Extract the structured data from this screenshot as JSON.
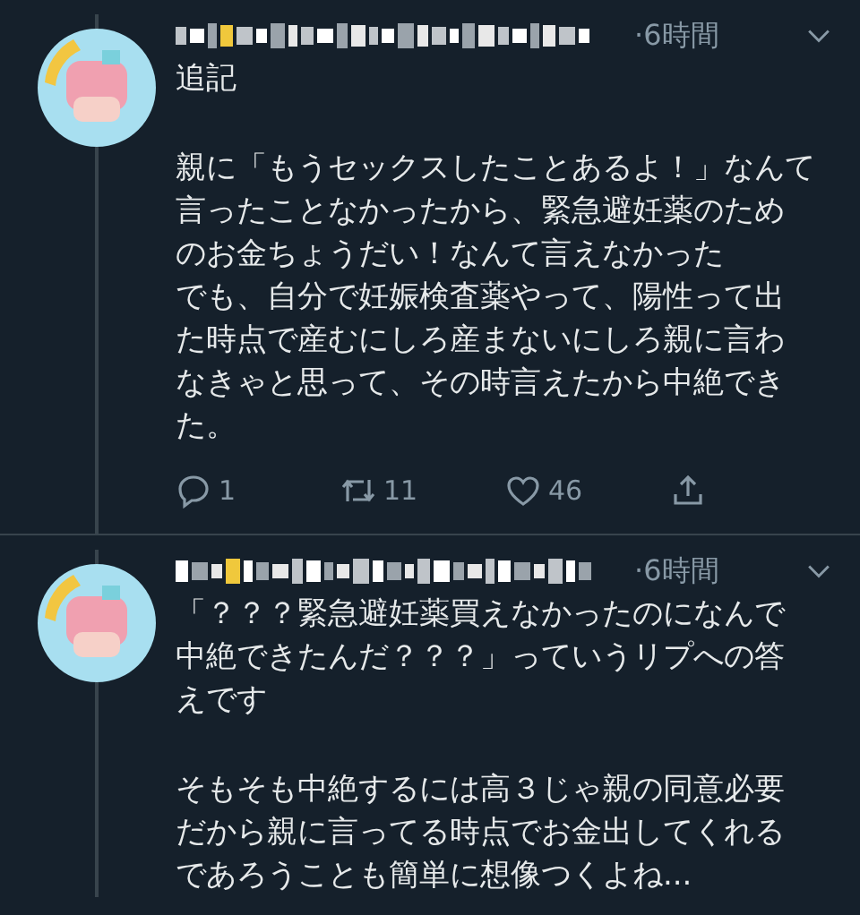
{
  "tweets": [
    {
      "time": "·6時間",
      "paragraphs": [
        [
          "追記"
        ],
        [
          "親に「もうセックスしたことあるよ！」なんて",
          "言ったことなかったから、緊急避妊薬のため",
          "のお金ちょうだい！なんて言えなかった",
          "でも、自分で妊娠検査薬やって、陽性って出",
          "た時点で産むにしろ産まないにしろ親に言わ",
          "なきゃと思って、その時言えたから中絶でき",
          "た。"
        ]
      ],
      "actions": {
        "replies": "1",
        "retweets": "11",
        "likes": "46"
      }
    },
    {
      "time": "·6時間",
      "paragraphs": [
        [
          "「？？？緊急避妊薬買えなかったのになんで",
          "中絶できたんだ？？？」っていうリプへの答",
          "えです"
        ],
        [
          "そもそも中絶するには高３じゃ親の同意必要",
          "だから親に言ってる時点でお金出してくれる",
          "であろうことも簡単に想像つくよね..."
        ]
      ]
    }
  ]
}
